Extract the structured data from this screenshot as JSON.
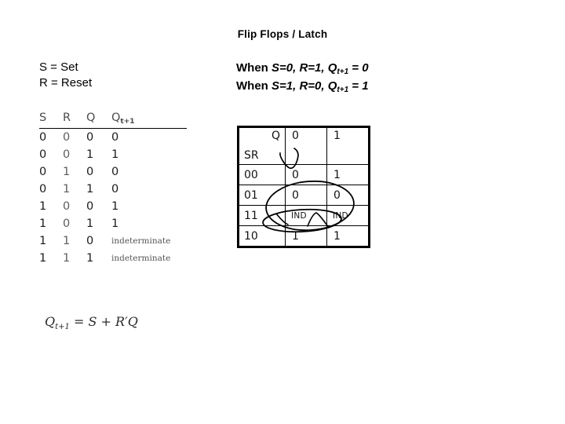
{
  "slide": {
    "title": "Flip Flops / Latch"
  },
  "legend": {
    "lines": [
      "S = Set",
      "R = Reset"
    ]
  },
  "notes": {
    "line1": {
      "prefix": "When ",
      "s_label": "S",
      "s_value": "=0, ",
      "r_label": "R",
      "r_value": "=1, ",
      "q_label": "Q",
      "q_sub": "t+1",
      "q_value": " = 0"
    },
    "line2": {
      "prefix": "When ",
      "s_label": "S",
      "s_value": "=1, ",
      "r_label": "R",
      "r_value": "=0, ",
      "q_label": "Q",
      "q_sub": "t+1",
      "q_value": " = 1"
    }
  },
  "truth_table": {
    "headers": {
      "s": "S",
      "r": "R",
      "q": "Q",
      "qnext": "Q",
      "qnext_sub": "t+1"
    },
    "rows": [
      {
        "s": "0",
        "r": "0",
        "q": "0",
        "qnext": "0",
        "indeterminate": false
      },
      {
        "s": "0",
        "r": "0",
        "q": "1",
        "qnext": "1",
        "indeterminate": false
      },
      {
        "s": "0",
        "r": "1",
        "q": "0",
        "qnext": "0",
        "indeterminate": false
      },
      {
        "s": "0",
        "r": "1",
        "q": "1",
        "qnext": "0",
        "indeterminate": false
      },
      {
        "s": "1",
        "r": "0",
        "q": "0",
        "qnext": "1",
        "indeterminate": false
      },
      {
        "s": "1",
        "r": "0",
        "q": "1",
        "qnext": "1",
        "indeterminate": false
      },
      {
        "s": "1",
        "r": "1",
        "q": "0",
        "qnext": "indeterminate",
        "indeterminate": true
      },
      {
        "s": "1",
        "r": "1",
        "q": "1",
        "qnext": "indeterminate",
        "indeterminate": true
      }
    ]
  },
  "kmap": {
    "corner_col_label": "Q",
    "corner_row_label": "SR",
    "col_headers": [
      "0",
      "1"
    ],
    "rows": [
      {
        "label": "00",
        "cells": [
          "0",
          "1"
        ]
      },
      {
        "label": "01",
        "cells": [
          "0",
          "0"
        ]
      },
      {
        "label": "11",
        "cells": [
          "IND",
          "IND"
        ]
      },
      {
        "label": "10",
        "cells": [
          "1",
          "1"
        ]
      }
    ],
    "annotations": [
      {
        "name": "group-loop-small",
        "shape": "ellipse-handdrawn"
      },
      {
        "name": "group-loop-large",
        "shape": "ellipse-handdrawn"
      },
      {
        "name": "group-loop-bottom",
        "shape": "ellipse-handdrawn"
      }
    ]
  },
  "equation": {
    "lhs": "Q",
    "lhs_sub": "t+1",
    "eq": " = ",
    "rhs_a": "S",
    "plus": " + ",
    "rhs_b": "R",
    "prime": "′",
    "rhs_c": "Q"
  },
  "colors": {
    "background": "#ffffff",
    "text": "#000000",
    "muted_text": "#555555",
    "rule": "#000000"
  }
}
